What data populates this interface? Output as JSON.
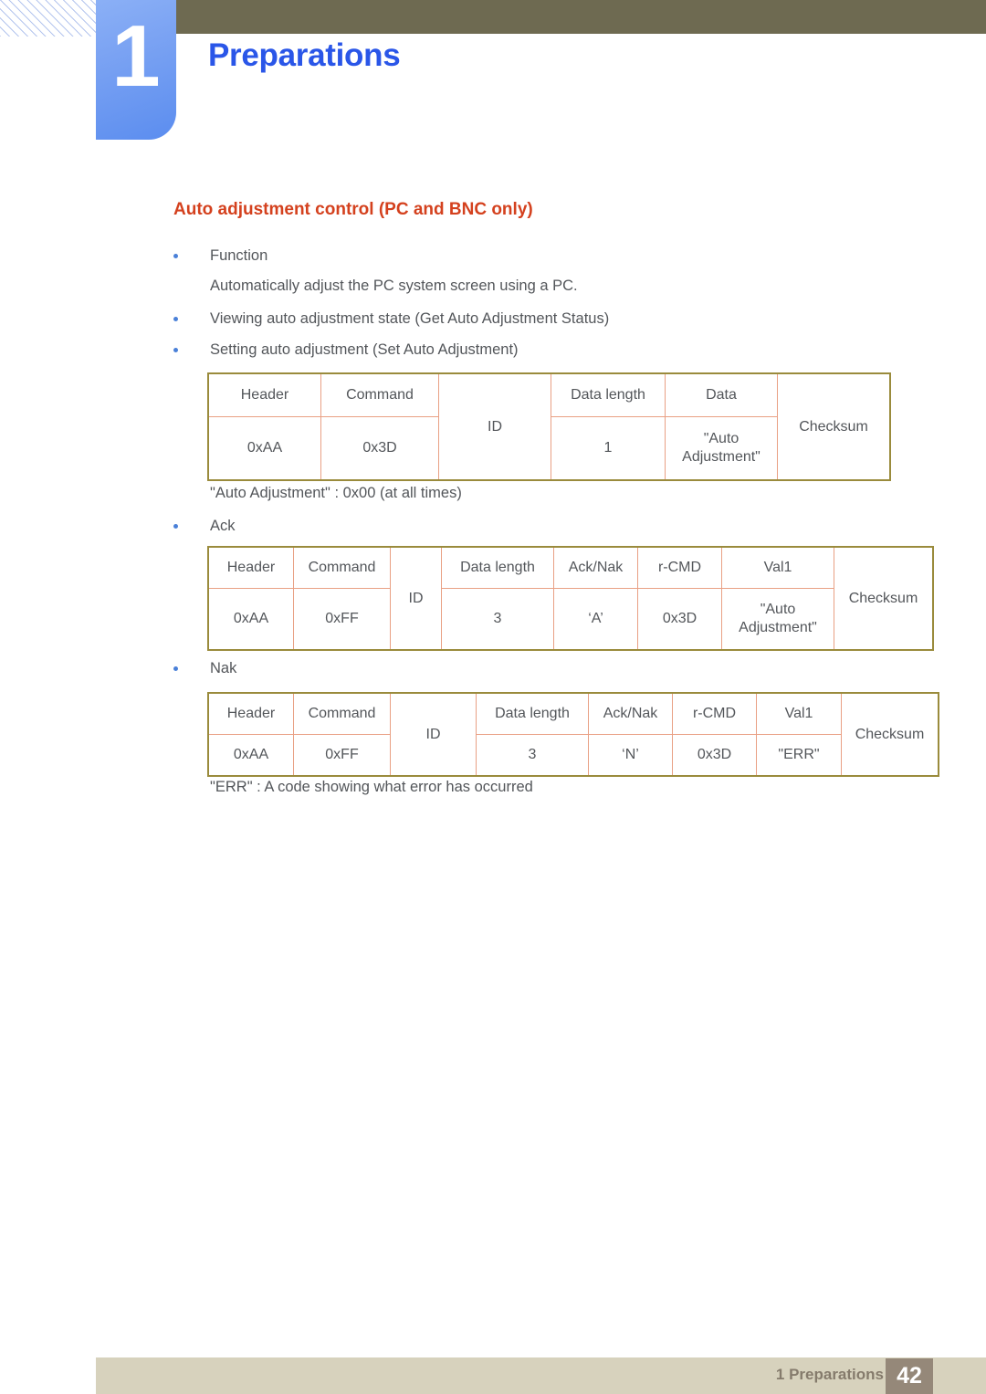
{
  "header": {
    "chapter_number": "1",
    "chapter_title": "Preparations",
    "olive_bar_color": "#6e6a51",
    "tab_color": "#5b8def",
    "title_color": "#2a56e8"
  },
  "section": {
    "title": "Auto adjustment control (PC and BNC only)",
    "title_color": "#d4411e"
  },
  "bullets": {
    "function": "Function",
    "function_desc": "Automatically adjust the PC system screen using a PC.",
    "viewing": "Viewing auto adjustment state (Get Auto Adjustment Status)",
    "setting": "Setting auto adjustment (Set Auto Adjustment)",
    "ack": "Ack",
    "nak": "Nak"
  },
  "notes": {
    "auto_adjustment_note": "\"Auto Adjustment\" : 0x00 (at all times)",
    "err_note": "\"ERR\" : A code showing what error has occurred"
  },
  "tables": {
    "set_command": {
      "headers": [
        "Header",
        "Command",
        "ID",
        "Data length",
        "Data",
        "Checksum"
      ],
      "values": [
        "0xAA",
        "0x3D",
        "1",
        "\"Auto Adjustment\""
      ],
      "data_cell_line1": "\"Auto",
      "data_cell_line2": "Adjustment\""
    },
    "ack": {
      "headers": [
        "Header",
        "Command",
        "ID",
        "Data length",
        "Ack/Nak",
        "r-CMD",
        "Val1",
        "Checksum"
      ],
      "values": [
        "0xAA",
        "0xFF",
        "3",
        "‘A’",
        "0x3D",
        "\"Auto Adjustment\""
      ],
      "val1_line1": "\"Auto",
      "val1_line2": "Adjustment\""
    },
    "nak": {
      "headers": [
        "Header",
        "Command",
        "ID",
        "Data length",
        "Ack/Nak",
        "r-CMD",
        "Val1",
        "Checksum"
      ],
      "values": [
        "0xAA",
        "0xFF",
        "3",
        "‘N’",
        "0x3D",
        "\"ERR\""
      ]
    },
    "border_outer_color": "#9a8b3c",
    "border_inner_color": "#e9a084"
  },
  "footer": {
    "label": "1 Preparations",
    "page_number": "42",
    "bar_color": "#d7d2bd",
    "badge_color": "#958879"
  }
}
